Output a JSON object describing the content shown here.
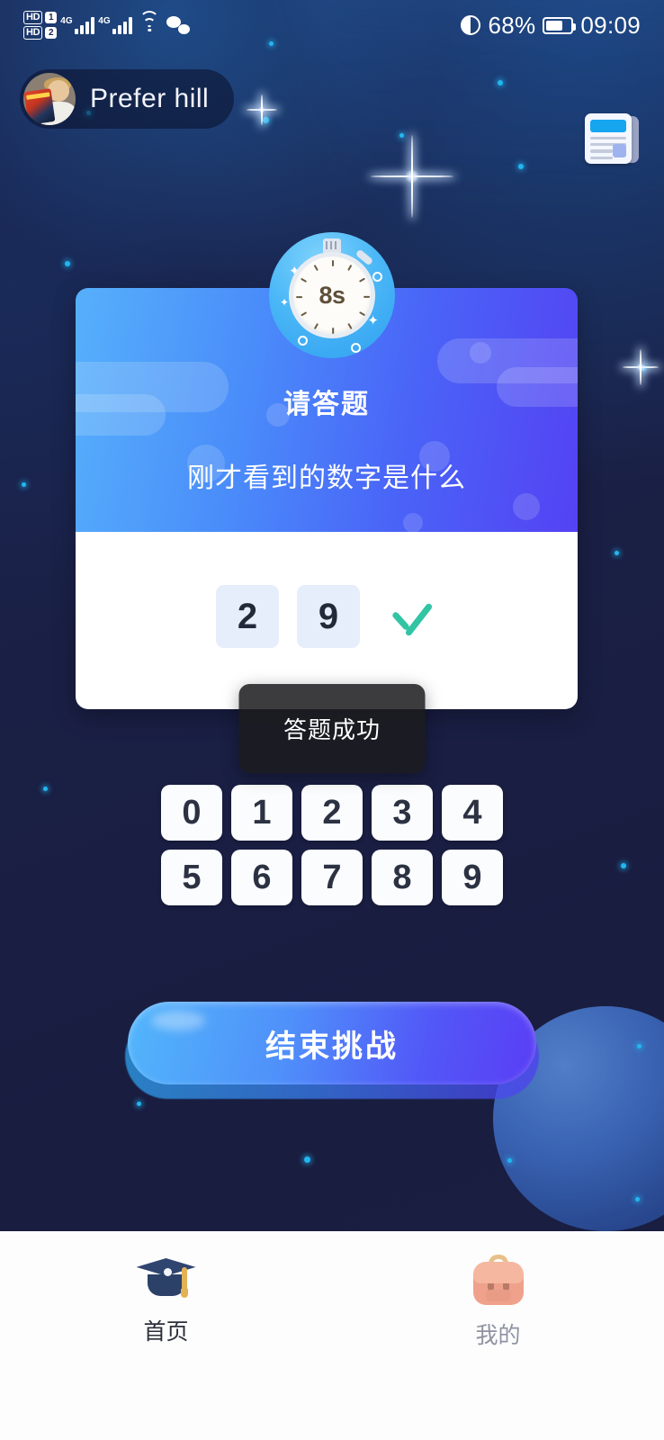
{
  "status_bar": {
    "hd1_label": "HD",
    "hd1_sim": "1",
    "hd2_label": "HD",
    "hd2_sim": "2",
    "network_1": "4G",
    "network_2": "4G",
    "wifi_icon": "wifi-icon",
    "wechat_icon": "wechat-icon",
    "eye_icon": "eye-comfort-icon",
    "battery_percent": "68%",
    "time": "09:09"
  },
  "header": {
    "username": "Prefer hill",
    "avatar_icon": "user-avatar",
    "rules_icon": "rules-document-icon"
  },
  "timer": {
    "value": "8s",
    "icon": "stopwatch-icon"
  },
  "question_card": {
    "title": "请答题",
    "subtitle": "刚才看到的数字是什么",
    "answers": [
      "2",
      "9"
    ],
    "result_icon": "checkmark-icon"
  },
  "toast": {
    "message": "答题成功"
  },
  "keypad": {
    "row1": [
      "0",
      "1",
      "2",
      "3",
      "4"
    ],
    "row2": [
      "5",
      "6",
      "7",
      "8",
      "9"
    ]
  },
  "cta": {
    "label": "结束挑战"
  },
  "tabbar": {
    "tabs": [
      {
        "label": "首页",
        "icon": "graduation-cap-icon",
        "active": true
      },
      {
        "label": "我的",
        "icon": "backpack-icon",
        "active": false
      }
    ]
  },
  "colors": {
    "background": "#1a2046",
    "card_gradient_start": "#56b0fb",
    "card_gradient_end": "#5442f3",
    "accent_green": "#32c5a4",
    "slot_bg": "#e6edfb",
    "star_blue": "#22b6f0"
  }
}
